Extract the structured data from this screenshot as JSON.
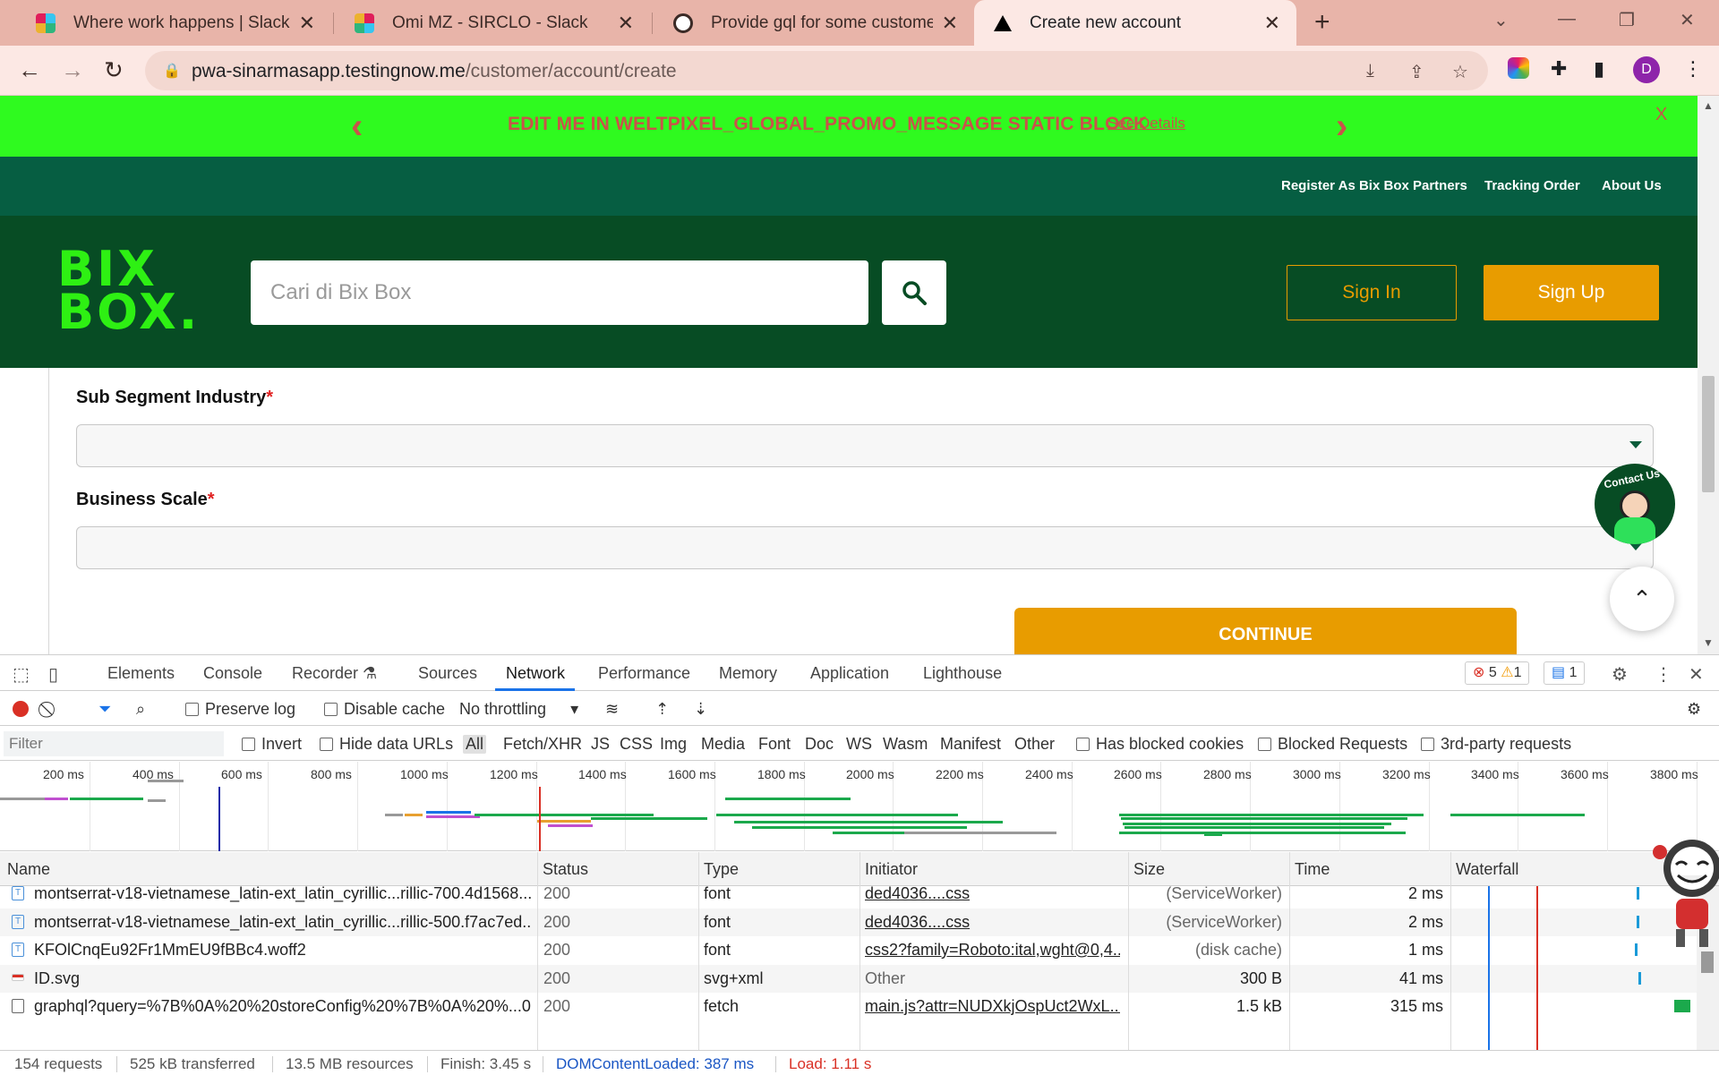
{
  "browser": {
    "tabs": [
      {
        "title": "Where work happens | Slack",
        "favicon_color": "#36c5f0",
        "active": false
      },
      {
        "title": "Omi MZ - SIRCLO - Slack",
        "favicon_color": "#e01e5a",
        "active": false
      },
      {
        "title": "Provide gql for some customer in",
        "favicon_color": "#ffffff",
        "active": false
      },
      {
        "title": "Create new account",
        "favicon_color": "#000000",
        "active": true
      }
    ],
    "close_glyph": "✕",
    "new_tab_glyph": "+",
    "url_host": "pwa-sinarmasapp.testingnow.me",
    "url_path": "/customer/account/create",
    "profile_initial": "D"
  },
  "page": {
    "promo": {
      "message": "EDIT ME IN WELTPIXEL_GLOBAL_PROMO_MESSAGE STATIC BLOCK",
      "details_link": "See Details",
      "close": "X",
      "background": "#2ffa1f",
      "text_color": "#c9534a"
    },
    "topnav": [
      {
        "label": "Register As Bix Box Partners"
      },
      {
        "label": "Tracking Order"
      },
      {
        "label": "About Us"
      }
    ],
    "header": {
      "logo_line1": "BIX",
      "logo_line2": "BOX.",
      "search_placeholder": "Cari di Bix Box",
      "signin_label": "Sign In",
      "signup_label": "Sign Up",
      "brand_color": "#074c24",
      "accent_color": "#e89c00"
    },
    "form": {
      "fields": [
        {
          "label": "Sub Segment Industry",
          "required_mark": "*",
          "value": ""
        },
        {
          "label": "Business Scale",
          "required_mark": "*",
          "value": ""
        }
      ],
      "continue_label": "CONTINUE"
    },
    "contact_us": "Contact Us"
  },
  "devtools": {
    "tabs": [
      "Elements",
      "Console",
      "Recorder",
      "Sources",
      "Network",
      "Performance",
      "Memory",
      "Application",
      "Lighthouse"
    ],
    "active_tab": "Network",
    "errors": "5",
    "warnings": "1",
    "messages": "1",
    "toolbar": {
      "preserve_log": "Preserve log",
      "disable_cache": "Disable cache",
      "throttling": "No throttling"
    },
    "filter": {
      "placeholder": "Filter",
      "invert": "Invert",
      "hide_data_urls": "Hide data URLs",
      "types": [
        "All",
        "Fetch/XHR",
        "JS",
        "CSS",
        "Img",
        "Media",
        "Font",
        "Doc",
        "WS",
        "Wasm",
        "Manifest",
        "Other"
      ],
      "selected_type": "All",
      "has_blocked_cookies": "Has blocked cookies",
      "blocked_requests": "Blocked Requests",
      "third_party": "3rd-party requests"
    },
    "timeline_ticks": [
      "200 ms",
      "400 ms",
      "600 ms",
      "800 ms",
      "1000 ms",
      "1200 ms",
      "1400 ms",
      "1600 ms",
      "1800 ms",
      "2000 ms",
      "2200 ms",
      "2400 ms",
      "2600 ms",
      "2800 ms",
      "3000 ms",
      "3200 ms",
      "3400 ms",
      "3600 ms",
      "3800 ms"
    ],
    "columns": [
      "Name",
      "Status",
      "Type",
      "Initiator",
      "Size",
      "Time",
      "Waterfall"
    ],
    "requests": [
      {
        "name": "montserrat-v18-vietnamese_latin-ext_latin_cyrillic...rillic-700.4d1568...",
        "status": "200",
        "type": "font",
        "initiator": "ded4036....css",
        "size": "(ServiceWorker)",
        "time": "2 ms",
        "icon": "font"
      },
      {
        "name": "montserrat-v18-vietnamese_latin-ext_latin_cyrillic...rillic-500.f7ac7ed...",
        "status": "200",
        "type": "font",
        "initiator": "ded4036....css",
        "size": "(ServiceWorker)",
        "time": "2 ms",
        "icon": "font"
      },
      {
        "name": "KFOlCnqEu92Fr1MmEU9fBBc4.woff2",
        "status": "200",
        "type": "font",
        "initiator": "css2?family=Roboto:ital,wght@0,4...",
        "size": "(disk cache)",
        "time": "1 ms",
        "icon": "font"
      },
      {
        "name": "ID.svg",
        "status": "200",
        "type": "svg+xml",
        "initiator": "Other",
        "size": "300 B",
        "time": "41 ms",
        "icon": "svg"
      },
      {
        "name": "graphql?query=%7B%0A%20%20storeConfig%20%7B%0A%20%...0...",
        "status": "200",
        "type": "fetch",
        "initiator": "main.js?attr=NUDXkjOspUct2WxL...",
        "size": "1.5 kB",
        "time": "315 ms",
        "icon": "fetch"
      }
    ],
    "status": {
      "requests": "154 requests",
      "transferred": "525 kB transferred",
      "resources": "13.5 MB resources",
      "finish": "Finish: 3.45 s",
      "dom_content_loaded": "DOMContentLoaded: 387 ms",
      "load": "Load: 1.11 s"
    }
  }
}
